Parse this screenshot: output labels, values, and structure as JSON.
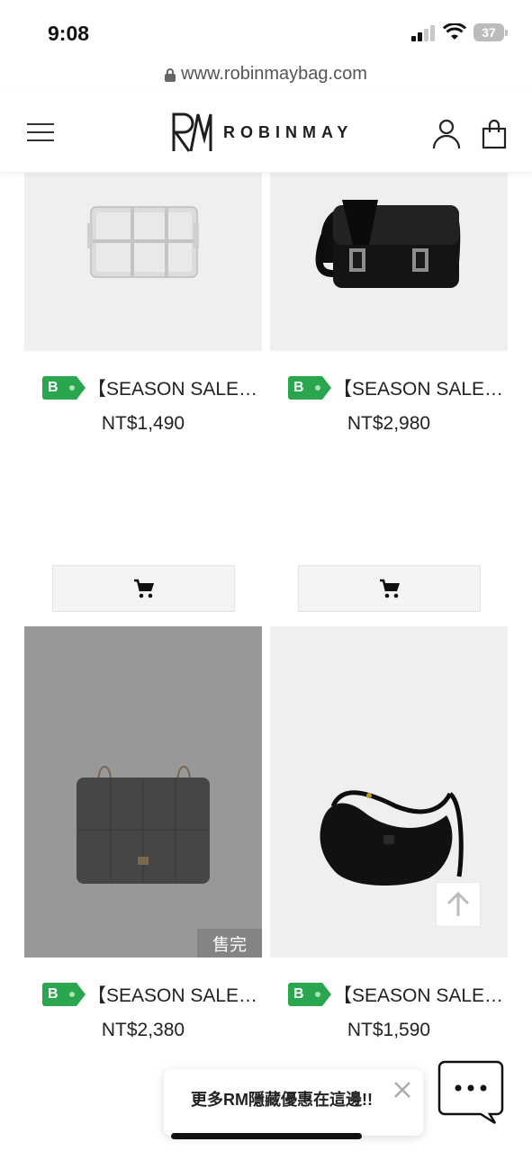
{
  "status_bar": {
    "time": "9:08",
    "battery": "37"
  },
  "url_bar": {
    "url": "www.robinmaybag.com"
  },
  "header": {
    "brand": "ROBINMAY"
  },
  "products": [
    {
      "badge": "B",
      "title": "【SEASON SALE…",
      "price": "NT$1,490",
      "sold_out": false,
      "image": "silver-woven-crossbody-bag"
    },
    {
      "badge": "B",
      "title": "【SEASON SALE…",
      "price": "NT$2,980",
      "sold_out": false,
      "image": "black-buckle-messenger-bag"
    },
    {
      "badge": "B",
      "title": "【SEASON SALE…",
      "price": "NT$2,380",
      "sold_out": true,
      "sold_out_label": "售完",
      "image": "dark-quilted-tote-bag"
    },
    {
      "badge": "B",
      "title": "【SEASON SALE…",
      "price": "NT$1,590",
      "sold_out": false,
      "image": "black-shoulder-hobo-bag"
    }
  ],
  "promo": {
    "text": "更多RM隱藏優惠在這邊!!"
  },
  "colors": {
    "badge_green": "#2aa64e",
    "overlay_gray": "#7a7a7a"
  },
  "icons": [
    "menu-icon",
    "user-icon",
    "shopping-bag-icon",
    "cart-icon",
    "arrow-up-icon",
    "close-icon",
    "chat-icon",
    "lock-icon",
    "wifi-icon",
    "signal-icon"
  ]
}
